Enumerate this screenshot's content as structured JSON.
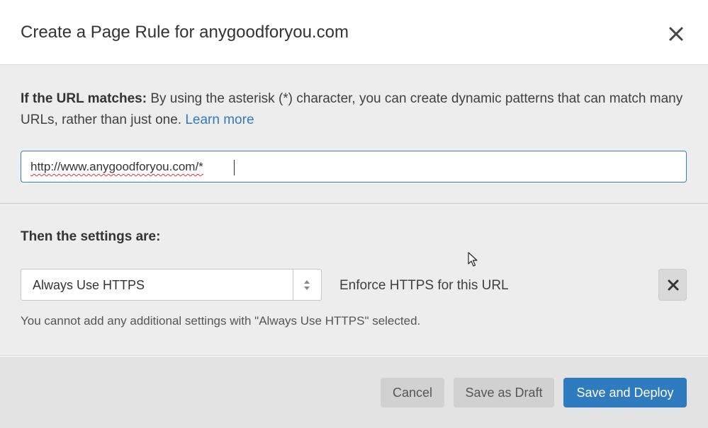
{
  "dialog": {
    "title": "Create a Page Rule for anygoodforyou.com",
    "close_icon": "close-icon"
  },
  "url_section": {
    "label": "If the URL matches:",
    "description": " By using the asterisk (*) character, you can create dynamic patterns that can match many URLs, rather than just one. ",
    "learn_more": "Learn more",
    "url_value": "http://www.anygoodforyou.com/*"
  },
  "settings_section": {
    "heading": "Then the settings are:",
    "setting_select": {
      "value": "Always Use HTTPS"
    },
    "setting_description": "Enforce HTTPS for this URL",
    "remove_icon": "close-icon",
    "warning": "You cannot add any additional settings with \"Always Use HTTPS\" selected."
  },
  "footer": {
    "cancel_label": "Cancel",
    "draft_label": "Save as Draft",
    "deploy_label": "Save and Deploy"
  },
  "colors": {
    "accent": "#2f7bbf",
    "section_bg": "#ededed",
    "footer_bg": "#e3e3e3"
  }
}
